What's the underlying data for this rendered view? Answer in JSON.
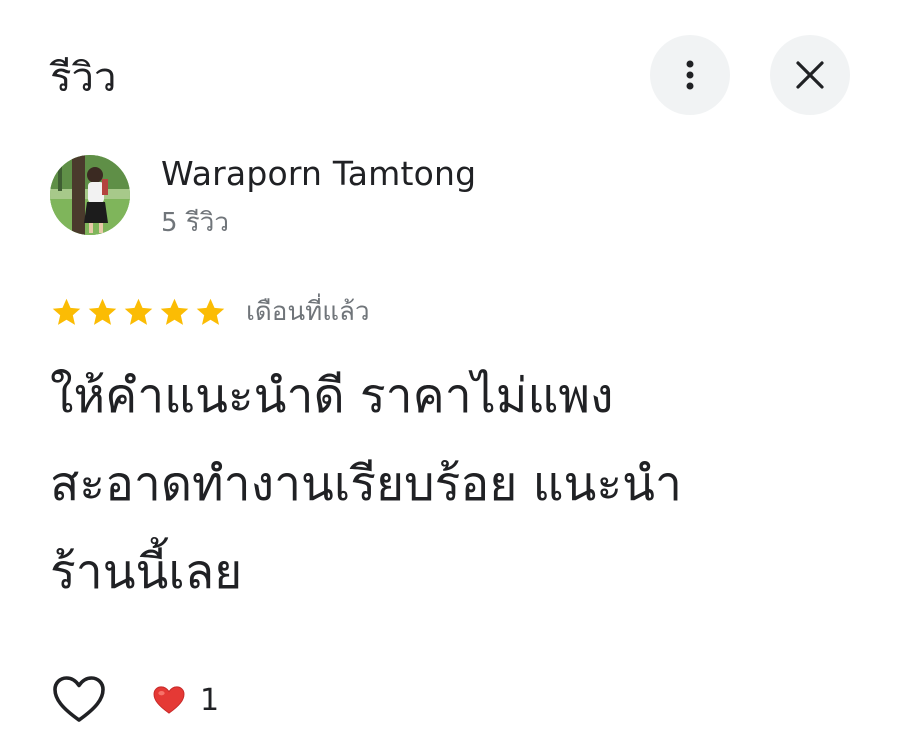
{
  "header": {
    "title": "รีวิว",
    "more_icon": "more-vertical-icon",
    "close_icon": "close-icon"
  },
  "author": {
    "name": "Waraporn Tamtong",
    "review_count": "5 รีวิว"
  },
  "review": {
    "rating": 5,
    "max_rating": 5,
    "date": "เดือนที่แล้ว",
    "text": "ให้คำแนะนำดี ราคาไม่แพง\nสะอาดทำงานเรียบร้อย แนะนำ\nร้านนี้เลย"
  },
  "reactions": {
    "like_icon": "heart-outline-icon",
    "reaction_icon": "red-heart-icon",
    "count": "1"
  },
  "colors": {
    "star": "#fbbc04",
    "button_bg": "#f1f3f4",
    "heart": "#e53935",
    "secondary_text": "#70757a"
  }
}
